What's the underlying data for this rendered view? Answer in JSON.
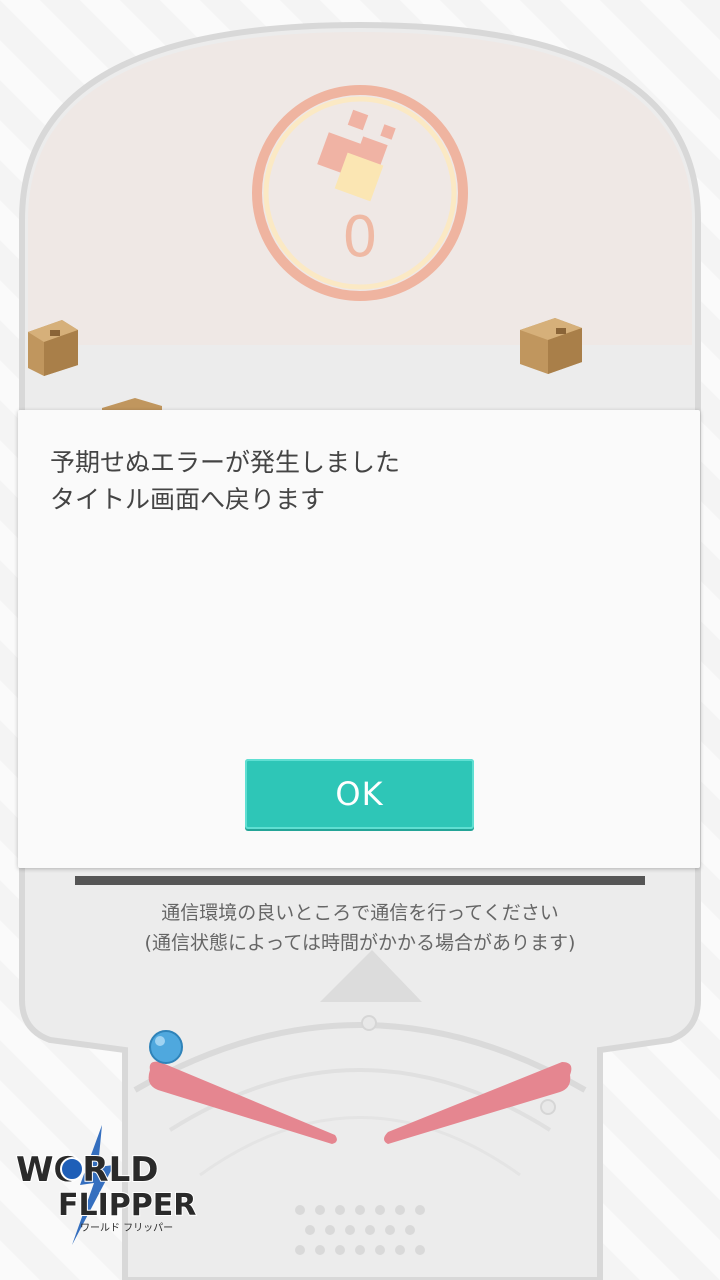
{
  "game": {
    "counter_value": "0",
    "progress_fraction": 1.0
  },
  "dialog": {
    "message": "予期せぬエラーが発生しました\nタイトル画面へ戻ります",
    "ok_label": "OK"
  },
  "network_hint": "通信環境の良いところで通信を行ってください\n(通信状態によっては時間がかかる場合があります)",
  "logo": {
    "text_top": "WORLD",
    "text_bottom": "FLIPPER",
    "subtitle": "ワールド フリッパー"
  },
  "colors": {
    "accent": "#2ec6b7",
    "flipper": "#e58690",
    "ball": "#4fa8de",
    "counter_ring": "#efb4a0"
  }
}
